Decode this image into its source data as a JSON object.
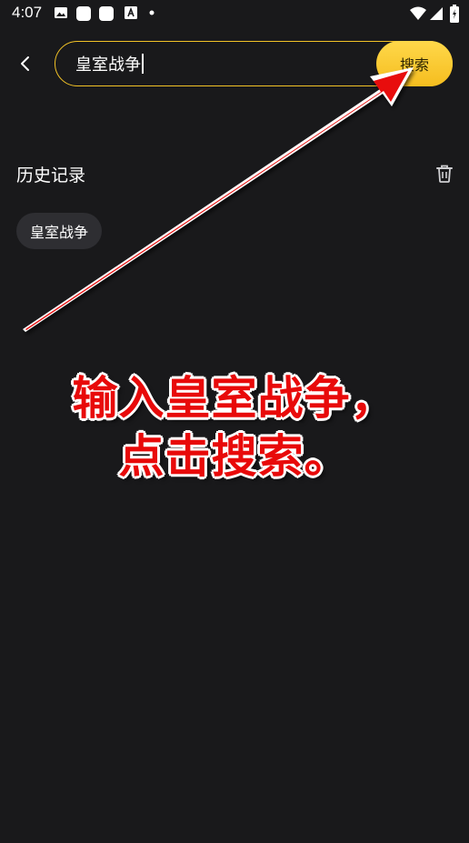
{
  "status_bar": {
    "time": "4:07"
  },
  "search": {
    "value": "皇室战争",
    "button_label": "搜索"
  },
  "history": {
    "title": "历史记录",
    "items": [
      "皇室战争"
    ]
  },
  "annotation": {
    "line1": "输入皇室战争，",
    "line2": "点击搜索。"
  },
  "colors": {
    "background": "#19191b",
    "accent": "#f5bd1f",
    "chip": "#2e2e32",
    "annotation_red": "#e80a0a"
  },
  "icons": [
    "image-icon",
    "square-app-icon",
    "square-app-icon",
    "text-box-icon",
    "dot-icon",
    "wifi-icon",
    "signal-icon",
    "battery-icon",
    "chevron-left-icon",
    "trash-icon",
    "red-arrow-annotation"
  ]
}
